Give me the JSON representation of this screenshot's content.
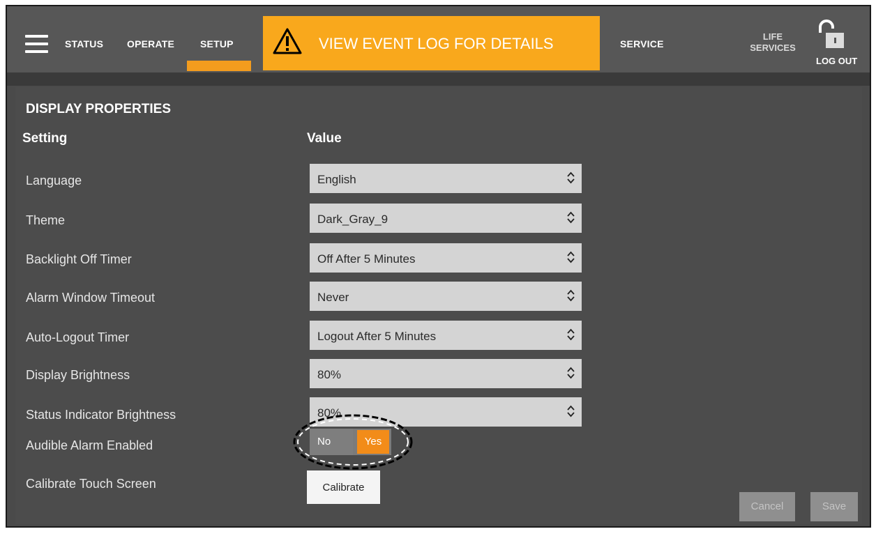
{
  "nav": {
    "tabs": [
      {
        "label": "STATUS"
      },
      {
        "label": "OPERATE"
      },
      {
        "label": "SETUP",
        "active": true
      },
      {
        "label": "SERVICE"
      }
    ],
    "banner": {
      "text": "VIEW EVENT LOG FOR DETAILS",
      "icon": "warning-icon"
    },
    "life_services": "LIFE SERVICES",
    "logout": "LOG OUT"
  },
  "panel": {
    "title": "DISPLAY PROPERTIES",
    "columns": {
      "setting": "Setting",
      "value": "Value"
    },
    "rows": [
      {
        "label": "Language",
        "value": "English"
      },
      {
        "label": "Theme",
        "value": "Dark_Gray_9"
      },
      {
        "label": "Backlight Off Timer",
        "value": "Off After 5 Minutes"
      },
      {
        "label": "Alarm Window Timeout",
        "value": "Never"
      },
      {
        "label": "Auto-Logout Timer",
        "value": "Logout After 5 Minutes"
      },
      {
        "label": "Display Brightness",
        "value": "80%"
      },
      {
        "label": "Status Indicator Brightness",
        "value": "80%"
      },
      {
        "label": "Audible Alarm Enabled"
      },
      {
        "label": "Calibrate Touch Screen"
      }
    ],
    "toggle": {
      "no": "No",
      "yes": "Yes",
      "selected": "Yes"
    },
    "calibrate": "Calibrate",
    "cancel": "Cancel",
    "save": "Save"
  },
  "colors": {
    "accent": "#f39c1e",
    "banner": "#f9a81c",
    "background": "#4c4c4c",
    "topbar": "#575757"
  }
}
